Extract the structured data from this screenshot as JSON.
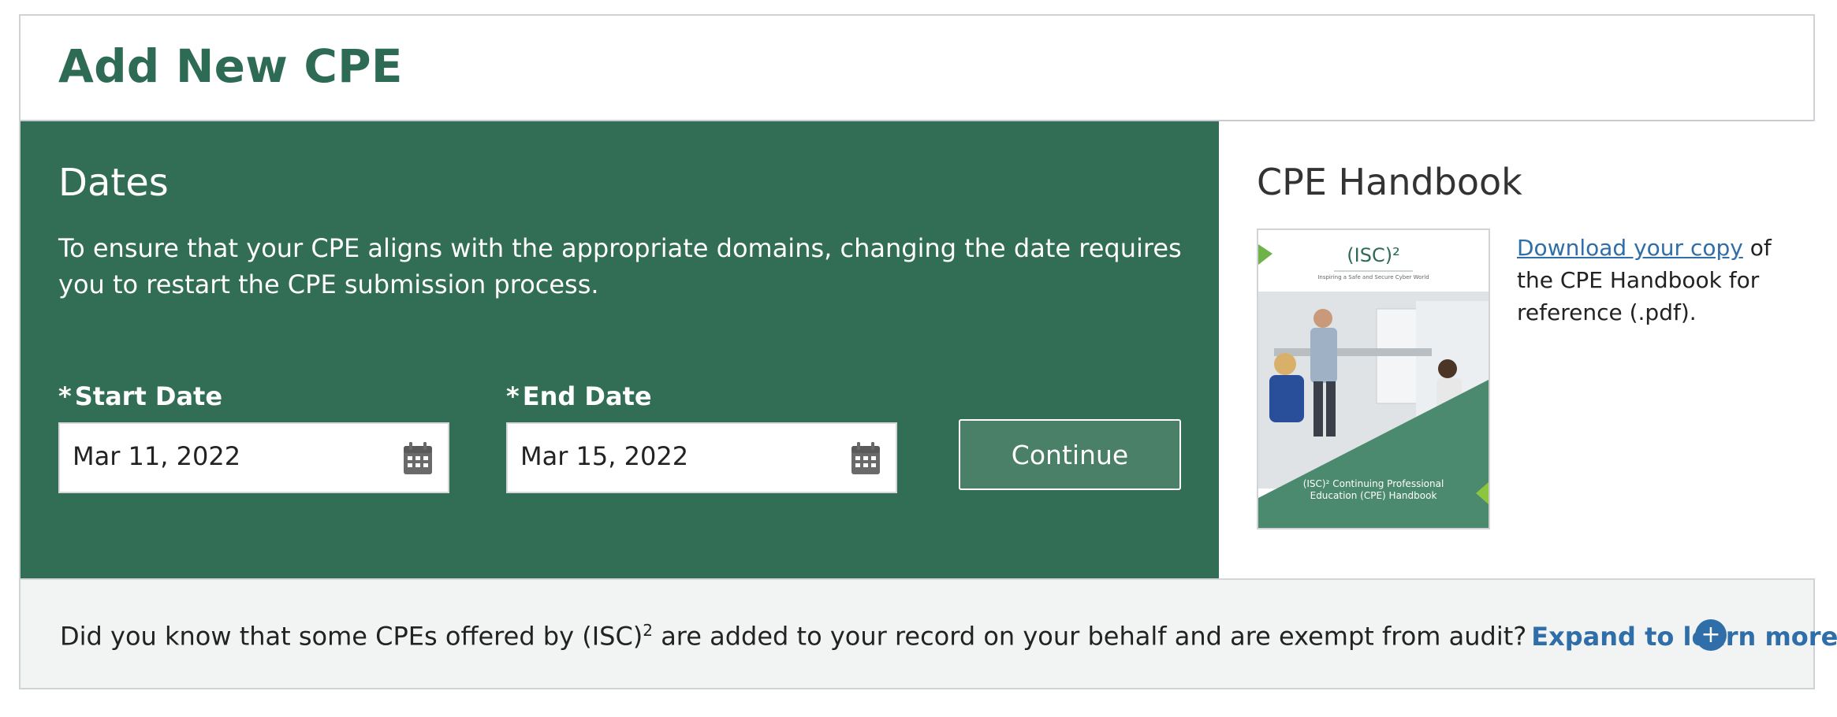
{
  "header": {
    "title": "Add New CPE"
  },
  "dates": {
    "heading": "Dates",
    "description": "To ensure that your CPE aligns with the appropriate domains, changing the date requires you to restart the CPE submission process.",
    "required_marker": "*",
    "start": {
      "label": "Start Date",
      "value": "Mar 11, 2022",
      "icon": "calendar-icon"
    },
    "end": {
      "label": "End Date",
      "value": "Mar 15, 2022",
      "icon": "calendar-icon"
    },
    "continue_label": "Continue"
  },
  "handbook": {
    "heading": "CPE Handbook",
    "link_text": "Download your copy",
    "text_after": " of the CPE Handbook for reference (.pdf).",
    "cover": {
      "logo": "(ISC)²",
      "tagline": "Inspiring a Safe and Secure Cyber World",
      "caption_line1": "(ISC)² Continuing Professional",
      "caption_line2": "Education (CPE) Handbook"
    }
  },
  "footer": {
    "text_before": "Did you know that some CPEs offered by (ISC)",
    "superscript": "2",
    "text_after": " are added to your record on your behalf and are exempt from audit?",
    "expand_label": "Expand to learn more.",
    "expand_icon": "+"
  },
  "colors": {
    "brand_green": "#316e55",
    "title_green": "#2e6b55",
    "link_blue": "#2f6ea8",
    "footer_bg": "#f2f3f3"
  }
}
